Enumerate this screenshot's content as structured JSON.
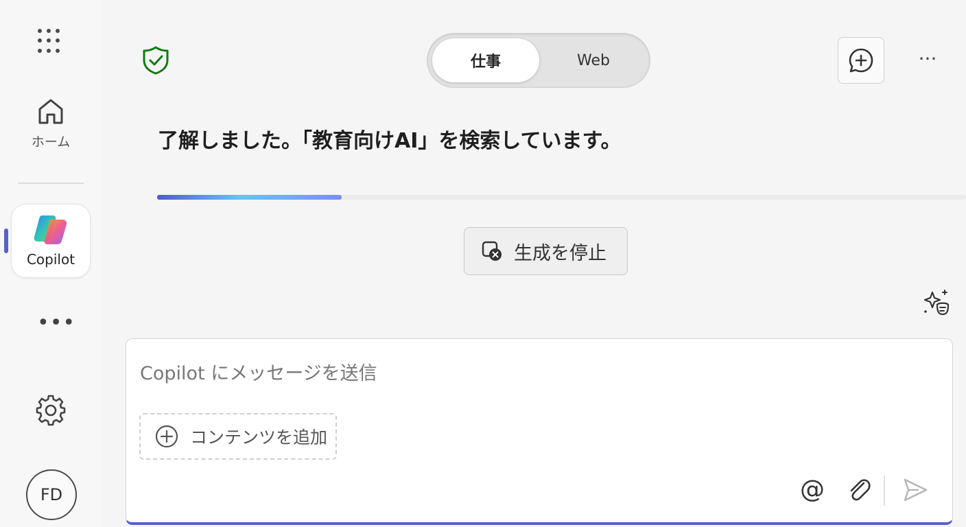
{
  "rail": {
    "home_label": "ホーム",
    "copilot_label": "Copilot",
    "more_glyph": "•••",
    "avatar_initials": "FD"
  },
  "header": {
    "mode_work": "仕事",
    "mode_web": "Web",
    "more_glyph": "···"
  },
  "conversation": {
    "status_message": "了解しました。「教育向けAI」を検索しています。",
    "progress": 0.228,
    "stop_label": "生成を停止"
  },
  "composer": {
    "placeholder": "Copilot にメッセージを送信",
    "value": "",
    "add_content_label": "コンテンツを追加",
    "mention_glyph": "@"
  },
  "colors": {
    "accent": "#5b5fc7",
    "shield_green": "#107c10",
    "progress_start": "#4f5bd5",
    "progress_end": "#7b8ff0"
  },
  "icons": {
    "apps": "waffle-icon",
    "home": "home-icon",
    "copilot": "copilot-logo-icon",
    "settings": "gear-icon",
    "protected": "shield-check-icon",
    "new_chat": "chat-add-icon",
    "stop": "stop-circle-icon",
    "prompts": "sparkle-list-icon",
    "add": "plus-circle-icon",
    "attach": "paperclip-icon",
    "send": "send-icon"
  }
}
